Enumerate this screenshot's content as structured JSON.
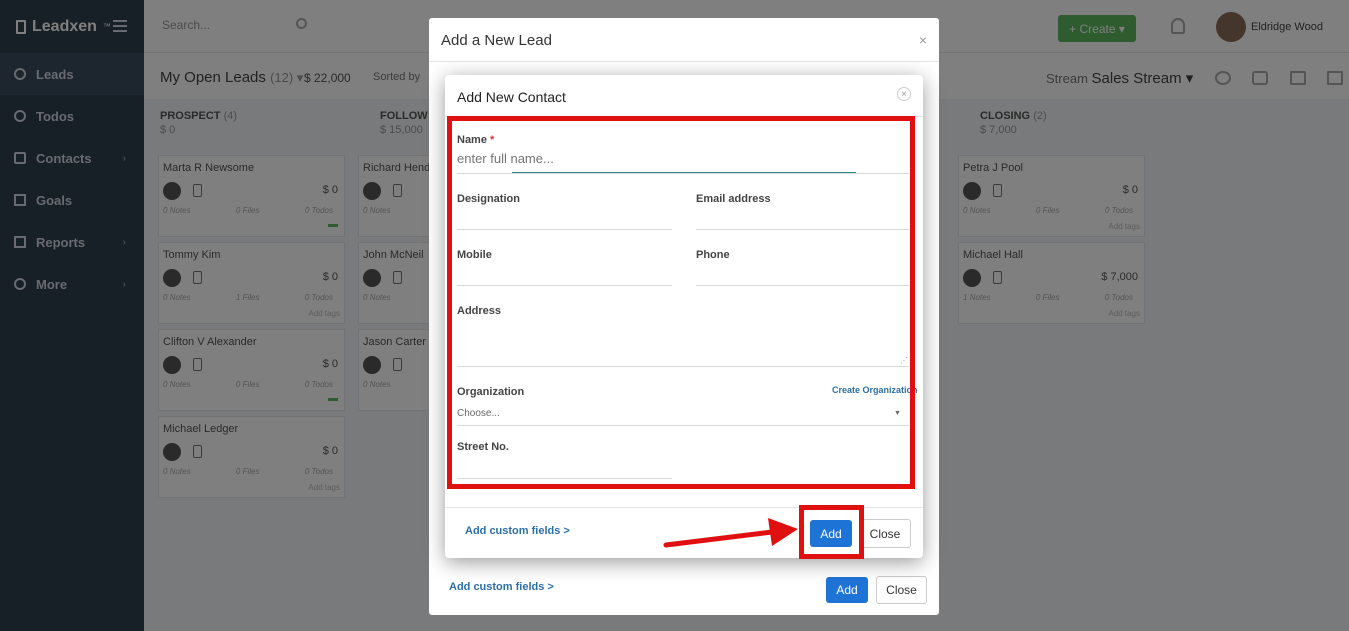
{
  "app": {
    "logo": "Leadxen",
    "logo_tm": "™"
  },
  "sidebar": {
    "items": [
      {
        "label": "Leads"
      },
      {
        "label": "Todos"
      },
      {
        "label": "Contacts",
        "has_chevron": true
      },
      {
        "label": "Goals"
      },
      {
        "label": "Reports",
        "has_chevron": true
      },
      {
        "label": "More",
        "has_chevron": true
      }
    ]
  },
  "topbar": {
    "search_placeholder": "Search...",
    "create_label": "+ Create ▾",
    "user_name": "Eldridge Wood"
  },
  "subbar": {
    "title": "My Open Leads",
    "count": "(12) ▾",
    "amount": "$ 22,000",
    "sorted": "Sorted by",
    "stream_label": "Stream",
    "stream_value": "Sales Stream ▾"
  },
  "board": {
    "columns": [
      {
        "name": "PROSPECT",
        "count": "(4)",
        "amount": "$ 0"
      },
      {
        "name": "FOLLOW",
        "count": "",
        "amount": "$ 15,000"
      },
      {
        "name": "CLOSING",
        "count": "(2)",
        "amount": "$ 7,000"
      }
    ],
    "cards": [
      {
        "name": "Marta R Newsome",
        "amount": "$ 0",
        "notes": "0 Notes",
        "files": "0 Files",
        "todos": "0 Todos",
        "tags": ""
      },
      {
        "name": "Tommy Kim",
        "amount": "$ 0",
        "notes": "0 Notes",
        "files": "1 Files",
        "todos": "0 Todos",
        "tags": "Add tags"
      },
      {
        "name": "Clifton V Alexander",
        "amount": "$ 0",
        "notes": "0 Notes",
        "files": "0 Files",
        "todos": "0 Todos",
        "tags": ""
      },
      {
        "name": "Michael Ledger",
        "amount": "$ 0",
        "notes": "0 Notes",
        "files": "0 Files",
        "todos": "0 Todos",
        "tags": "Add tags"
      },
      {
        "name": "Richard Hende",
        "amount": "",
        "notes": "0 Notes",
        "files": "",
        "todos": "",
        "tags": ""
      },
      {
        "name": "John McNeil",
        "amount": "",
        "notes": "0 Notes",
        "files": "",
        "todos": "",
        "tags": ""
      },
      {
        "name": "Jason Carter",
        "amount": "",
        "notes": "0 Notes",
        "files": "",
        "todos": "",
        "tags": ""
      },
      {
        "name": "Petra J Pool",
        "amount": "$ 0",
        "notes": "0 Notes",
        "files": "0 Files",
        "todos": "0 Todos",
        "tags": "Add tags"
      },
      {
        "name": "Michael Hall",
        "amount": "$ 7,000",
        "notes": "1 Notes",
        "files": "0 Files",
        "todos": "0 Todos",
        "tags": "Add tags"
      }
    ]
  },
  "back_modal": {
    "title": "Add a New Lead",
    "custom_fields": "Add custom fields >",
    "add_label": "Add",
    "close_label": "Close"
  },
  "contact_modal": {
    "title": "Add New Contact",
    "name_label": "Name",
    "name_required": "*",
    "name_placeholder": "enter full name...",
    "designation_label": "Designation",
    "email_label": "Email address",
    "mobile_label": "Mobile",
    "phone_label": "Phone",
    "address_label": "Address",
    "organization_label": "Organization",
    "create_org_link": "Create Organization",
    "organization_value": "Choose...",
    "street_label": "Street No.",
    "custom_fields": "Add custom fields >",
    "add_label": "Add",
    "close_label": "Close"
  },
  "colors": {
    "annotation_red": "#e01010",
    "primary_blue": "#1e73d6",
    "link_blue": "#2b6fa8"
  }
}
